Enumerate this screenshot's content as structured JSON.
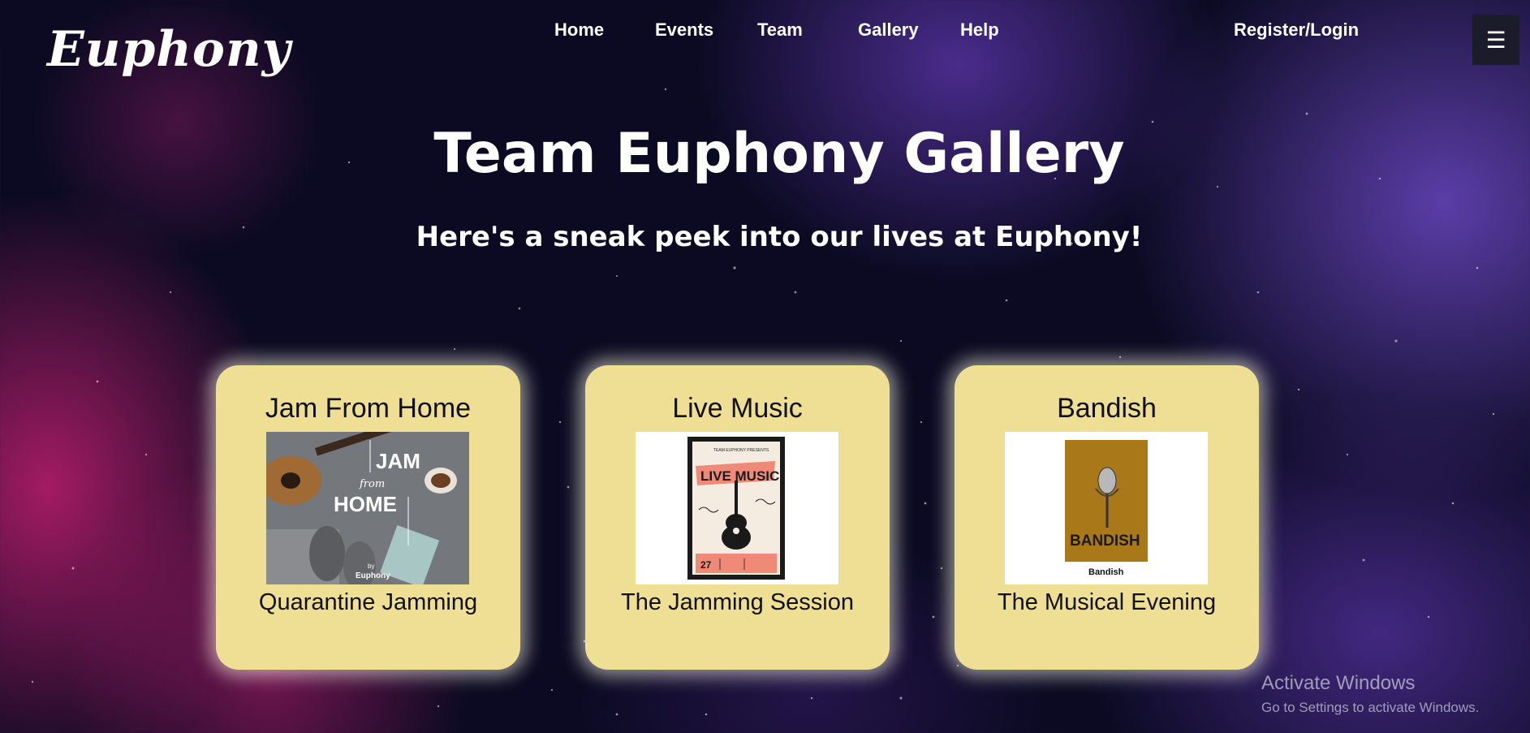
{
  "brand": {
    "logo_text": "Euphony"
  },
  "nav": {
    "items": [
      {
        "label": "Home"
      },
      {
        "label": "Events"
      },
      {
        "label": "Team"
      },
      {
        "label": "Gallery"
      },
      {
        "label": "Help"
      }
    ],
    "account_label": "Register/Login",
    "menu_icon": "hamburger-icon",
    "menu_glyph": "☰"
  },
  "hero": {
    "title": "Team Euphony Gallery",
    "subtitle": "Here's a sneak peek into our lives at Euphony!"
  },
  "cards": [
    {
      "title": "Jam From Home",
      "caption": "Quarantine Jamming",
      "poster": {
        "line1": "JAM",
        "line2": "from",
        "line3": "HOME",
        "byline_small": "by",
        "byline": "Euphony"
      }
    },
    {
      "title": "Live Music",
      "caption": "The Jamming Session",
      "poster": {
        "header": "TEAM EUPHONY PRESENTS",
        "banner": "LIVE MUSIC",
        "date": "27"
      }
    },
    {
      "title": "Bandish",
      "caption": "The Musical Evening",
      "poster": {
        "banner": "BANDISH",
        "label": "Bandish"
      }
    }
  ],
  "watermark": {
    "title": "Activate Windows",
    "subtitle": "Go to Settings to activate Windows."
  },
  "colors": {
    "card_bg": "#efdf95",
    "card_glow": "#fffbe6",
    "menu_bg": "#1b1b2a",
    "poster_pink": "#f08a78"
  }
}
